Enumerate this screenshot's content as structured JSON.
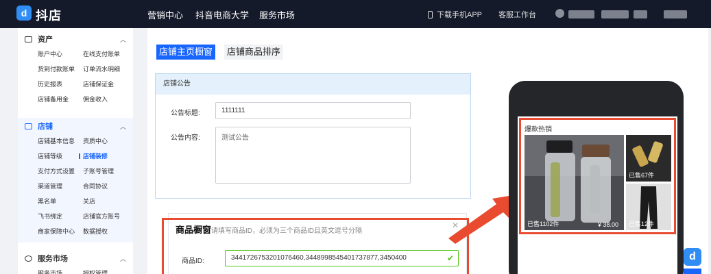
{
  "header": {
    "logo_text": "抖店",
    "nav": [
      "营销中心",
      "抖音电商大学",
      "服务市场"
    ],
    "download": "下载手机APP",
    "service": "客服工作台"
  },
  "sidebar": {
    "assets": {
      "title": "资产",
      "items": [
        "账户中心",
        "在线支付账单",
        "货到付款账单",
        "订单流水明细",
        "历史报表",
        "店铺保证金",
        "店铺备用金",
        "佣金收入"
      ]
    },
    "store": {
      "title": "店铺",
      "items": [
        "店铺基本信息",
        "资质中心",
        "店铺等级",
        "店铺装修",
        "支付方式设置",
        "子账号管理",
        "渠道管理",
        "合同协议",
        "黑名单",
        "关店",
        "飞书绑定",
        "店铺官方账号",
        "商家保障中心",
        "数据授权"
      ],
      "current": "店铺装修"
    },
    "market": {
      "title": "服务市场",
      "items": [
        "服务市场",
        "授权管理"
      ]
    }
  },
  "tabs": [
    "店铺主页橱窗",
    "店铺商品排序"
  ],
  "notice": {
    "header": "店铺公告",
    "title_label": "公告标题:",
    "title_value": "1111111",
    "content_label": "公告内容:",
    "content_value": "测试公告"
  },
  "shelf": {
    "title": "商品橱窗",
    "tip": "请填写商品ID，必须为三个商品ID且英文逗号分隔",
    "id_label": "商品ID:",
    "id_value": "3441726753201076460,3448998545401737877,3450400"
  },
  "preview": {
    "section_title": "爆款热销",
    "items": [
      {
        "sold": "已售1102件",
        "price": "¥ 38.00"
      },
      {
        "sold": "已售67件"
      },
      {
        "sold": "已售12件"
      }
    ]
  },
  "colors": {
    "accent": "#1966ff",
    "highlight": "#e84b2f",
    "topbar": "#151a2a"
  }
}
